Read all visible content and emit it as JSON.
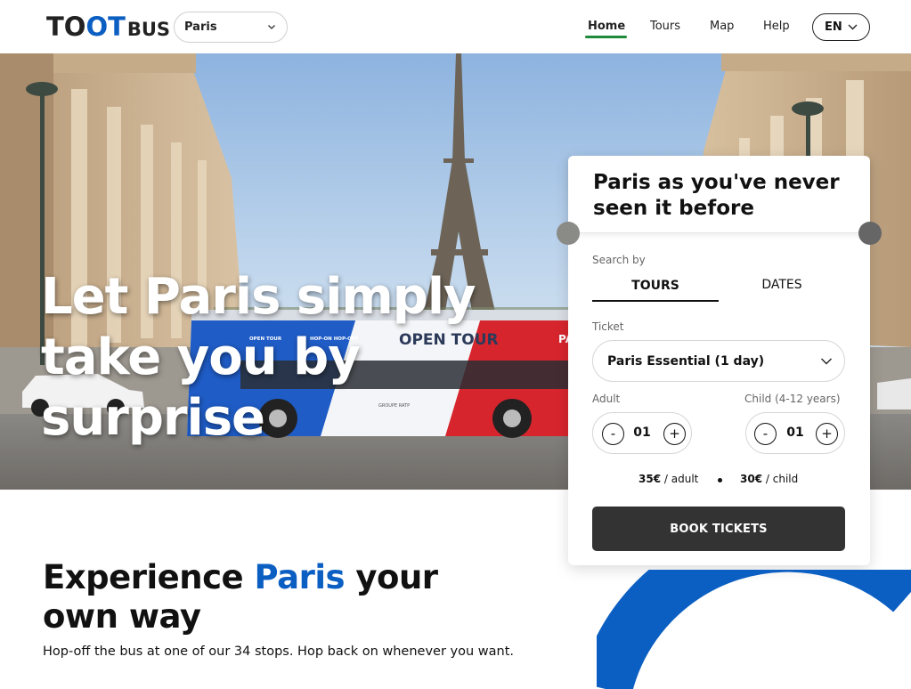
{
  "header": {
    "logo": {
      "text_a": "TO",
      "text_oo": "OT",
      "text_b": "BUS"
    },
    "city_select": {
      "value": "Paris"
    },
    "nav": [
      {
        "label": "Home",
        "active": true
      },
      {
        "label": "Tours",
        "active": false
      },
      {
        "label": "Map",
        "active": false
      },
      {
        "label": "Help",
        "active": false
      }
    ],
    "language": {
      "value": "EN"
    }
  },
  "hero": {
    "title_lines": [
      "Let Paris simply",
      "take you by",
      "surprise"
    ],
    "bus_labels": {
      "brand": "OPEN TOUR",
      "tag1": "OPEN TOUR",
      "tag2": "HOP-ON HOP-OFF",
      "side": "PA",
      "footer": "GROUPE RATP"
    }
  },
  "booking": {
    "title": "Paris as you've never seen it before",
    "search_by_label": "Search by",
    "tabs": [
      {
        "label": "TOURS",
        "active": true
      },
      {
        "label": "DATES",
        "active": false
      }
    ],
    "ticket_label": "Ticket",
    "ticket_value": "Paris Essential (1 day)",
    "adult": {
      "label": "Adult",
      "value": "01",
      "minus": "-",
      "plus": "+"
    },
    "child": {
      "label": "Child (4-12 years)",
      "value": "01",
      "minus": "-",
      "plus": "+"
    },
    "prices": {
      "adult_price": "35€",
      "adult_unit": "/ adult",
      "child_price": "30€",
      "child_unit": "/ child"
    },
    "book_button": "BOOK TICKETS"
  },
  "intro": {
    "title_pre": "Experience ",
    "title_accent": "Paris",
    "title_post": " your own way",
    "subtitle": "Hop-off the bus at one of our 34 stops. Hop back on whenever you want."
  },
  "colors": {
    "brand_blue": "#0c5fc2",
    "nav_active_green": "#1d8b3a",
    "button_dark": "#333333"
  },
  "icons": [
    "chevron-down-icon",
    "minus-icon",
    "plus-icon"
  ]
}
